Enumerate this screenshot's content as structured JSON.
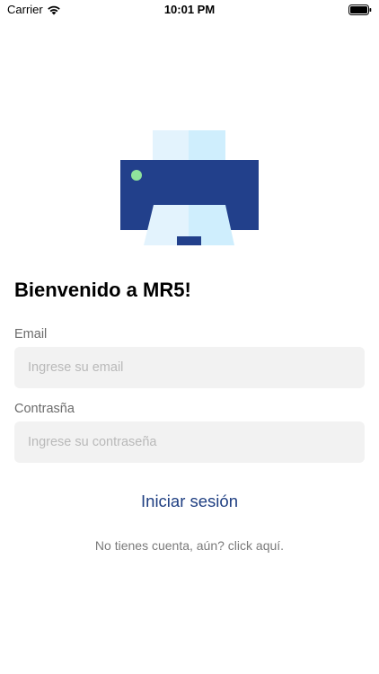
{
  "status_bar": {
    "carrier": "Carrier",
    "time": "10:01 PM",
    "wifi_icon": "wifi-icon",
    "battery_icon": "battery-icon"
  },
  "logo": {
    "icon": "printer-icon",
    "colors": {
      "body": "#22408b",
      "paper_light": "#e3f3fd",
      "paper_mid": "#cfeefd",
      "indicator": "#8fe39c"
    }
  },
  "title": "Bienvenido a MR5!",
  "form": {
    "email_label": "Email",
    "email_placeholder": "Ingrese su email",
    "email_value": "",
    "password_label": "Contrasña",
    "password_placeholder": "Ingrese su contraseña",
    "password_value": ""
  },
  "login_button": "Iniciar sesión",
  "signup_link": "No tienes cuenta, aún? click aquí.",
  "colors": {
    "accent": "#1f3f82",
    "input_bg": "#f2f2f2",
    "label": "#6b6b6b"
  }
}
